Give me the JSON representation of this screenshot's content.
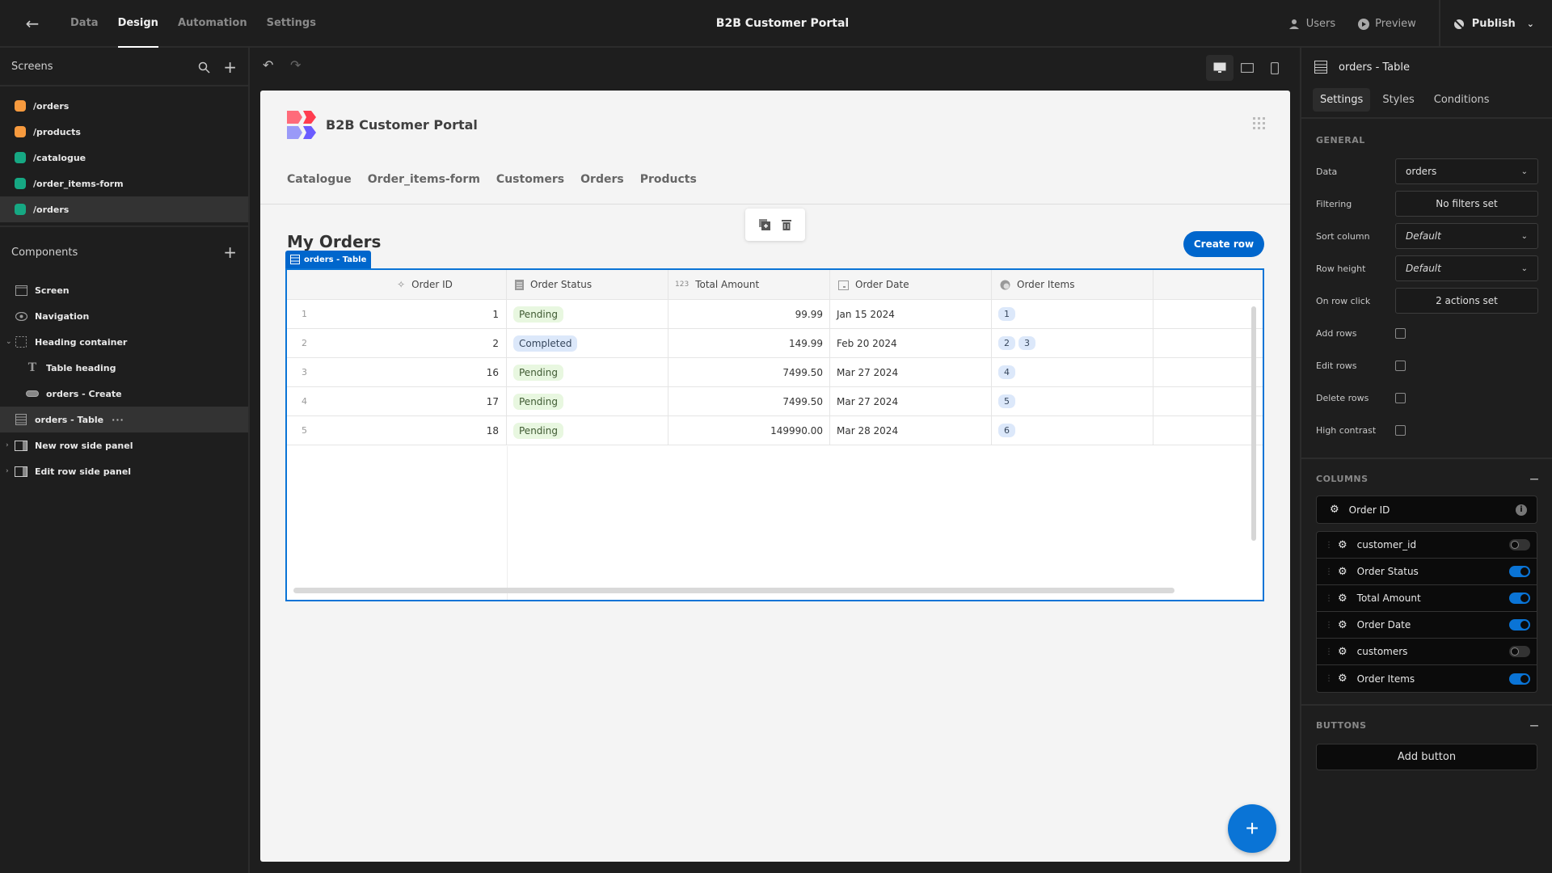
{
  "topbar": {
    "nav": [
      {
        "label": "Data",
        "active": false
      },
      {
        "label": "Design",
        "active": true
      },
      {
        "label": "Automation",
        "active": false
      },
      {
        "label": "Settings",
        "active": false
      }
    ],
    "app_title": "B2B Customer Portal",
    "users_label": "Users",
    "preview_label": "Preview",
    "publish_label": "Publish"
  },
  "sidebar": {
    "screens_title": "Screens",
    "screens": [
      {
        "label": "/orders",
        "color": "#f79a3e",
        "selected": false
      },
      {
        "label": "/products",
        "color": "#f79a3e",
        "selected": false
      },
      {
        "label": "/catalogue",
        "color": "#16a883",
        "selected": false
      },
      {
        "label": "/order_items-form",
        "color": "#16a883",
        "selected": false
      },
      {
        "label": "/orders",
        "color": "#16a883",
        "selected": true
      }
    ],
    "components_title": "Components",
    "components": [
      {
        "label": "Screen",
        "icon": "screen-icon"
      },
      {
        "label": "Navigation",
        "icon": "eye-icon"
      },
      {
        "label": "Heading container",
        "icon": "container-icon"
      },
      {
        "label": "Table heading",
        "icon": "text-icon"
      },
      {
        "label": "orders - Create",
        "icon": "button-icon"
      },
      {
        "label": "orders - Table",
        "icon": "table-icon"
      },
      {
        "label": "New row side panel",
        "icon": "side-panel-icon"
      },
      {
        "label": "Edit row side panel",
        "icon": "side-panel-icon"
      }
    ],
    "more_label": "···"
  },
  "canvas": {
    "page_title": "B2B Customer Portal",
    "nav_links": [
      "Catalogue",
      "Order_items-form",
      "Customers",
      "Orders",
      "Products"
    ],
    "heading": "My Orders",
    "create_button": "Create row",
    "table_tag": "orders - Table",
    "table": {
      "headers": [
        "Order ID",
        "Order Status",
        "Total Amount",
        "Order Date",
        "Order Items"
      ],
      "amount_icon_text": "123",
      "rows": [
        {
          "num": "1",
          "id": "1",
          "status": "Pending",
          "amount": "99.99",
          "date": "Jan 15 2024",
          "items": [
            "1"
          ]
        },
        {
          "num": "2",
          "id": "2",
          "status": "Completed",
          "amount": "149.99",
          "date": "Feb 20 2024",
          "items": [
            "2",
            "3"
          ]
        },
        {
          "num": "3",
          "id": "16",
          "status": "Pending",
          "amount": "7499.50",
          "date": "Mar 27 2024",
          "items": [
            "4"
          ]
        },
        {
          "num": "4",
          "id": "17",
          "status": "Pending",
          "amount": "7499.50",
          "date": "Mar 27 2024",
          "items": [
            "5"
          ]
        },
        {
          "num": "5",
          "id": "18",
          "status": "Pending",
          "amount": "149990.00",
          "date": "Mar 28 2024",
          "items": [
            "6"
          ]
        }
      ]
    },
    "fab_label": "+"
  },
  "rpanel": {
    "title": "orders - Table",
    "tabs": [
      {
        "label": "Settings",
        "active": true
      },
      {
        "label": "Styles",
        "active": false
      },
      {
        "label": "Conditions",
        "active": false
      }
    ],
    "general_label": "GENERAL",
    "fields": {
      "data": {
        "label": "Data",
        "value": "orders"
      },
      "filtering": {
        "label": "Filtering",
        "value": "No filters set"
      },
      "sort": {
        "label": "Sort column",
        "value": "Default"
      },
      "row_height": {
        "label": "Row height",
        "value": "Default"
      },
      "row_click": {
        "label": "On row click",
        "value": "2 actions set"
      }
    },
    "checkboxes": [
      {
        "label": "Add rows",
        "checked": false
      },
      {
        "label": "Edit rows",
        "checked": false
      },
      {
        "label": "Delete rows",
        "checked": false
      },
      {
        "label": "High contrast",
        "checked": false
      }
    ],
    "columns_label": "COLUMNS",
    "primary_column": "Order ID",
    "columns": [
      {
        "label": "customer_id",
        "enabled": false
      },
      {
        "label": "Order Status",
        "enabled": true
      },
      {
        "label": "Total Amount",
        "enabled": true
      },
      {
        "label": "Order Date",
        "enabled": true
      },
      {
        "label": "customers",
        "enabled": false
      },
      {
        "label": "Order Items",
        "enabled": true
      }
    ],
    "buttons_label": "BUTTONS",
    "add_button_label": "Add button"
  },
  "colors": {
    "accent": "#0066cc",
    "pending_bg": "#e8f7e0",
    "completed_bg": "#dce8fa"
  }
}
